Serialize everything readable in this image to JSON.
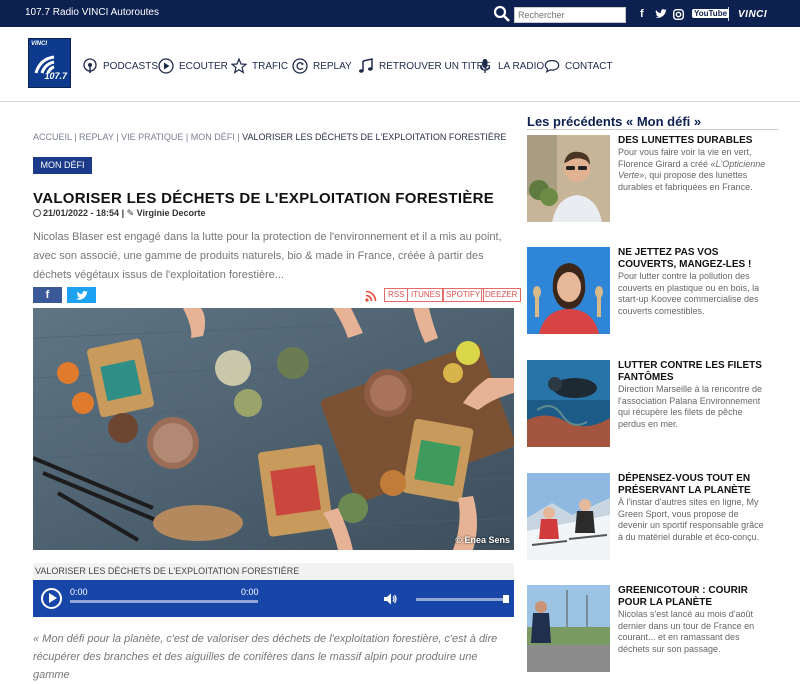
{
  "topbar": {
    "brand": "107.7 Radio VINCI Autoroutes",
    "search_placeholder": "Rechercher",
    "social": {
      "facebook": "f",
      "twitter": "t",
      "instagram": "ig",
      "youtube": "YouTube"
    },
    "vinci_label": "VINCI"
  },
  "header": {
    "logo_top": "VINCI",
    "logo_freq": "107.7",
    "nav": [
      {
        "label": "PODCASTS",
        "icon": "podcast-icon"
      },
      {
        "label": "ECOUTER",
        "icon": "play-circle-icon"
      },
      {
        "label": "TRAFIC",
        "icon": "star-icon"
      },
      {
        "label": "REPLAY",
        "icon": "replay-icon"
      },
      {
        "label": "RETROUVER UN TITRE",
        "icon": "music-note-icon"
      },
      {
        "label": "LA RADIO",
        "icon": "microphone-icon"
      },
      {
        "label": "CONTACT",
        "icon": "chat-icon"
      }
    ]
  },
  "article": {
    "breadcrumb": {
      "items": [
        "ACCUEIL",
        "REPLAY",
        "VIE PRATIQUE",
        "MON DÉFI"
      ],
      "current": "VALORISER LES DÉCHETS DE L'EXPLOITATION FORESTIÈRE"
    },
    "category": "MON DÉFI",
    "title": "VALORISER LES DÉCHETS DE L'EXPLOITATION FORESTIÈRE",
    "date": "21/01/2022 - 18:54",
    "author": "Virginie Decorte",
    "intro": "Nicolas Blaser est engagé dans la lutte pour la protection de l'environnement et il a mis au point, avec son associé, une gamme de produits naturels, bio & made in France, créée à partir des déchets végétaux issus de l'exploitation forestière...",
    "share": {
      "facebook": "f"
    },
    "podcast_links": [
      "RSS",
      "ITUNES",
      "SPOTIFY",
      "DEEZER"
    ],
    "photo_credit": "© Enea Sens",
    "audio": {
      "title": "VALORISER LES DÉCHETS DE L'EXPLOITATION FORESTIÈRE",
      "current_time": "0:00",
      "duration": "0:00",
      "progress": 0,
      "volume": 0.95
    },
    "quote": "« Mon défi pour la planète, c'est de valoriser des déchets de l'exploitation forestière, c'est à dire récupérer des branches et des aiguilles de conifères dans le massif alpin pour produire une gamme"
  },
  "sidebar": {
    "title": "Les précédents « Mon défi »",
    "cards": [
      {
        "title": "DES LUNETTES DURABLES",
        "desc_before": "Pour vous faire voir la vie en vert, Florence Girard a créé «",
        "desc_em": "L'Opticienne Verte",
        "desc_after": "», qui propose des lunettes durables et fabriquées en France."
      },
      {
        "title": "NE JETTEZ PAS VOS COUVERTS, MANGEZ-LES !",
        "desc": "Pour lutter contre la pollution des couverts en plastique ou en bois, la start-up Koovee commercialise des couverts comestibles."
      },
      {
        "title": "LUTTER CONTRE LES FILETS FANTÔMES",
        "desc": "Direction Marseille à la rencontre de l'association Palana Environnement qui récupère les filets de pêche perdus en mer."
      },
      {
        "title": "DÉPENSEZ-VOUS TOUT EN PRÉSERVANT LA PLANÈTE",
        "desc": "À l'instar d'autres sites en ligne, My Green Sport, vous propose de devenir un sportif responsable grâce à du matériel durable et éco-conçu."
      },
      {
        "title": "GREENICOTOUR : COURIR POUR LA PLANÈTE",
        "desc": "Nicolas s'est lancé au mois d'août dernier dans un tour de France en courant... et en ramassant des déchets sur son passage."
      }
    ]
  }
}
